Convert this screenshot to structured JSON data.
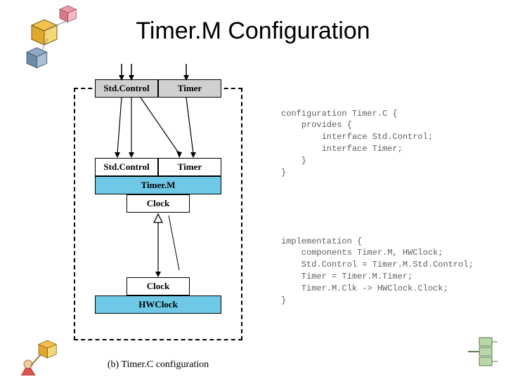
{
  "title": "Timer.M Configuration",
  "diagram": {
    "top": {
      "stdcontrol": "Std.Control",
      "timer": "Timer"
    },
    "mid": {
      "stdcontrol": "Std.Control",
      "timer": "Timer",
      "timerm": "Timer.M",
      "clock": "Clock"
    },
    "bottom": {
      "clock": "Clock",
      "hwclock": "HWClock"
    },
    "caption": "(b) Timer.C configuration"
  },
  "code": {
    "block1": "configuration Timer.C {\n    provides {\n        interface Std.Control;\n        interface Timer;\n    }\n}",
    "block2": "implementation {\n    components Timer.M, HWClock;\n    Std.Control = Timer.M.Std.Control;\n    Timer = Timer.M.Timer;\n    Timer.M.Clk -> HWClock.Clock;\n}"
  }
}
